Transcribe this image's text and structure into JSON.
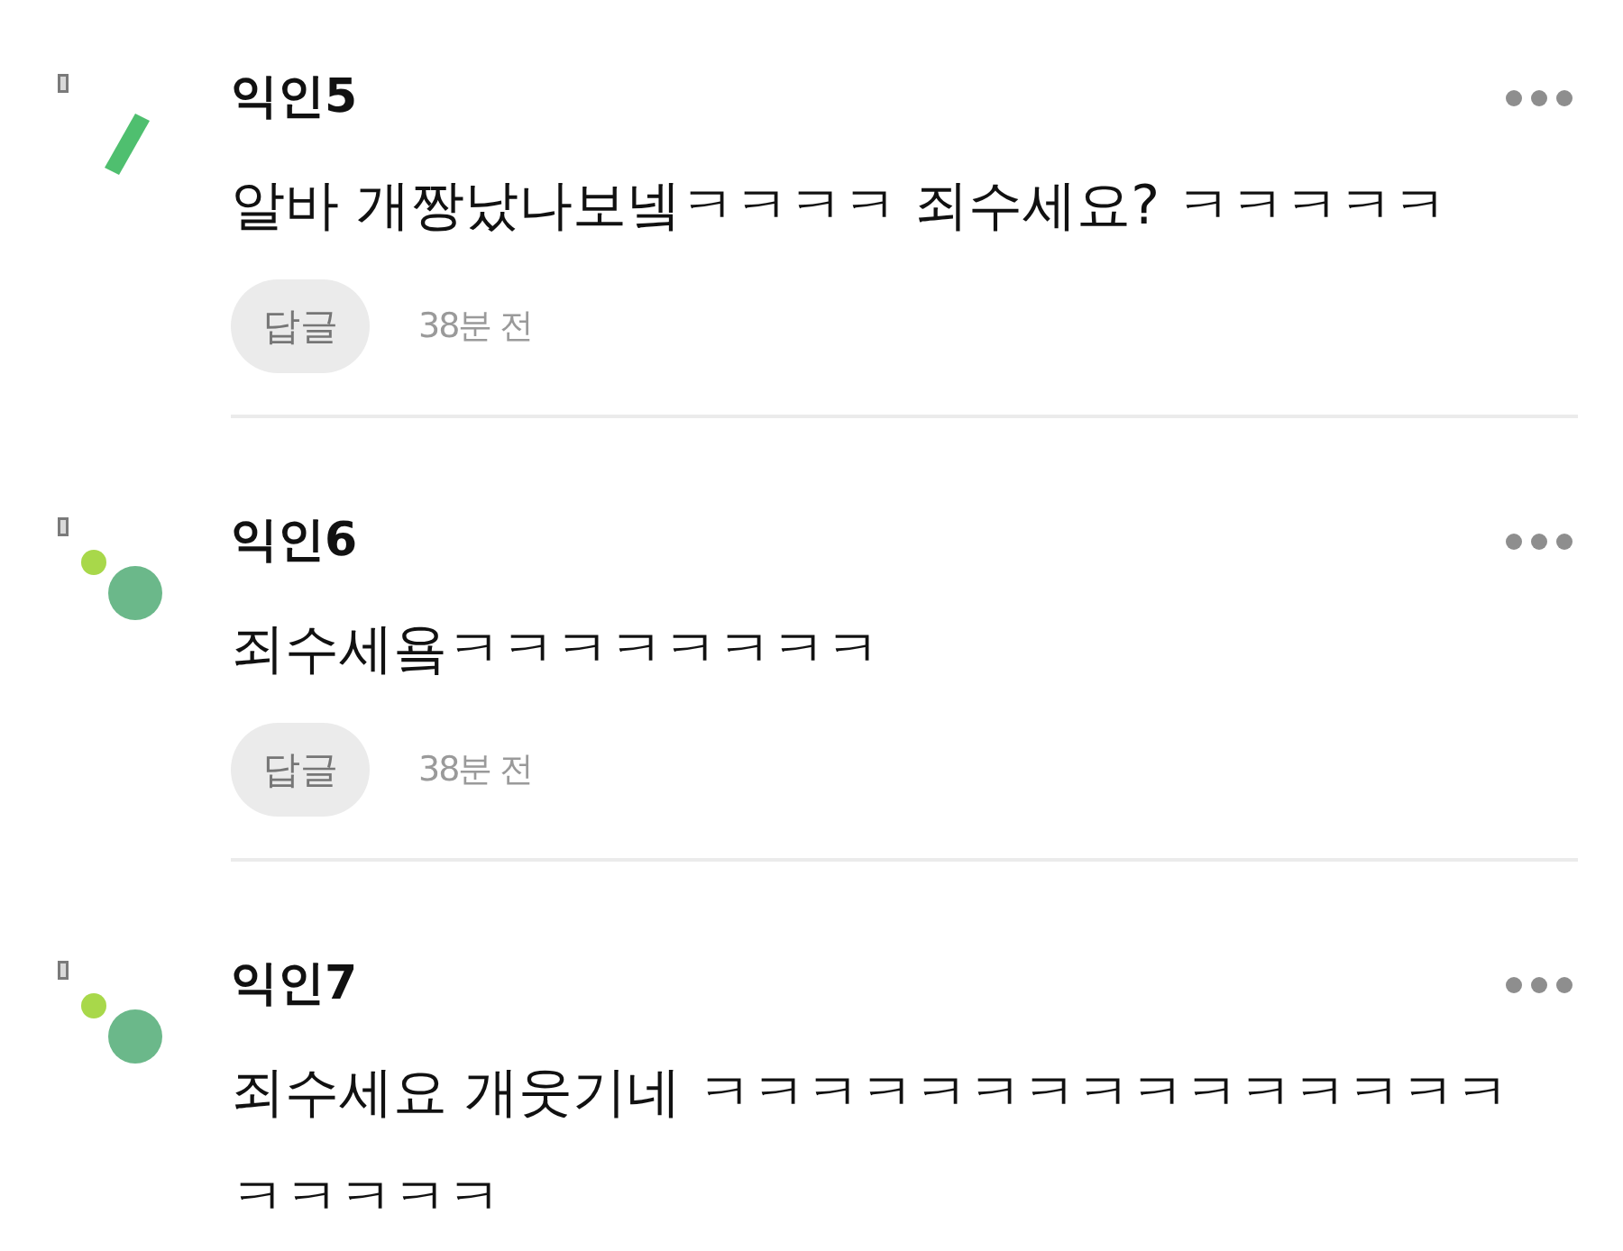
{
  "comments": [
    {
      "author": "익인5",
      "avatar": {
        "kind": "bar"
      },
      "body": "알바 개짱났나보넼ㅋㅋㅋㅋ 죄수세요? ㅋㅋㅋㅋㅋ",
      "reply_button": "답글",
      "time": "38분 전"
    },
    {
      "author": "익인6",
      "avatar": {
        "kind": "dots"
      },
      "body": "죄수세욬ㅋㅋㅋㅋㅋㅋㅋㅋ",
      "reply_button": "답글",
      "time": "38분 전"
    },
    {
      "author": "익인7",
      "avatar": {
        "kind": "dots"
      },
      "body": "죄수세요 개웃기네 ㅋㅋㅋㅋㅋㅋㅋㅋㅋㅋㅋㅋㅋㅋㅋㅋㅋㅋㅋㅋ"
    }
  ]
}
